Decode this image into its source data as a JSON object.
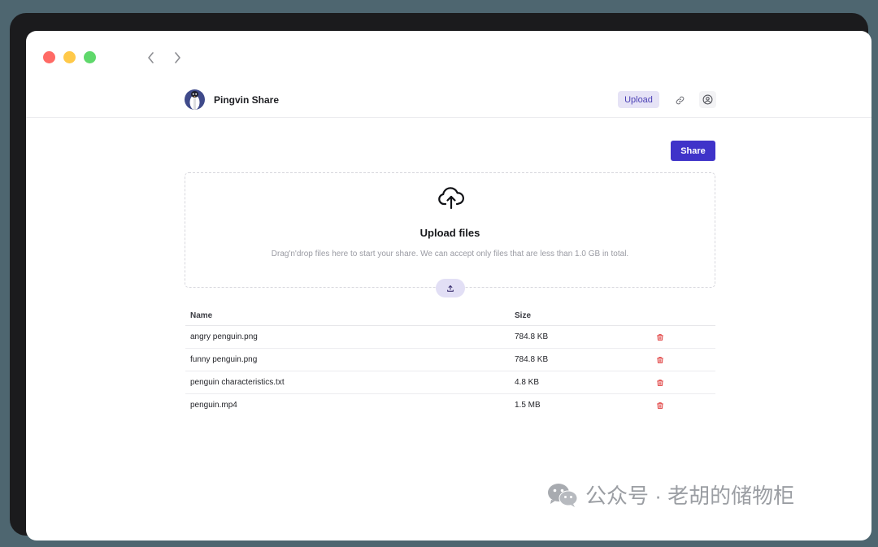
{
  "window": {
    "traffic_lights": {
      "close_color": "#ff5f57",
      "minimize_color": "#febc2e",
      "maximize_color": "#28c840"
    }
  },
  "header": {
    "brand": "Pingvin Share",
    "upload_label": "Upload",
    "accent_color": "#3f33c9"
  },
  "actions": {
    "share_label": "Share"
  },
  "dropzone": {
    "title": "Upload files",
    "description": "Drag'n'drop files here to start your share. We can accept only files that are less than 1.0 GB in total."
  },
  "table": {
    "headers": {
      "name": "Name",
      "size": "Size"
    },
    "rows": [
      {
        "name": "angry penguin.png",
        "size": "784.8 KB"
      },
      {
        "name": "funny penguin.png",
        "size": "784.8 KB"
      },
      {
        "name": "penguin characteristics.txt",
        "size": "4.8 KB"
      },
      {
        "name": "penguin.mp4",
        "size": "1.5 MB"
      }
    ]
  },
  "icons": {
    "back": "chevron-left-icon",
    "forward": "chevron-right-icon",
    "link": "link-icon",
    "user": "user-circle-icon",
    "upload_cloud": "cloud-upload-icon",
    "upload_small": "upload-arrow-icon",
    "delete": "trash-icon",
    "wechat": "wechat-icon"
  },
  "watermark": {
    "text": "公众号 · 老胡的储物柜"
  }
}
